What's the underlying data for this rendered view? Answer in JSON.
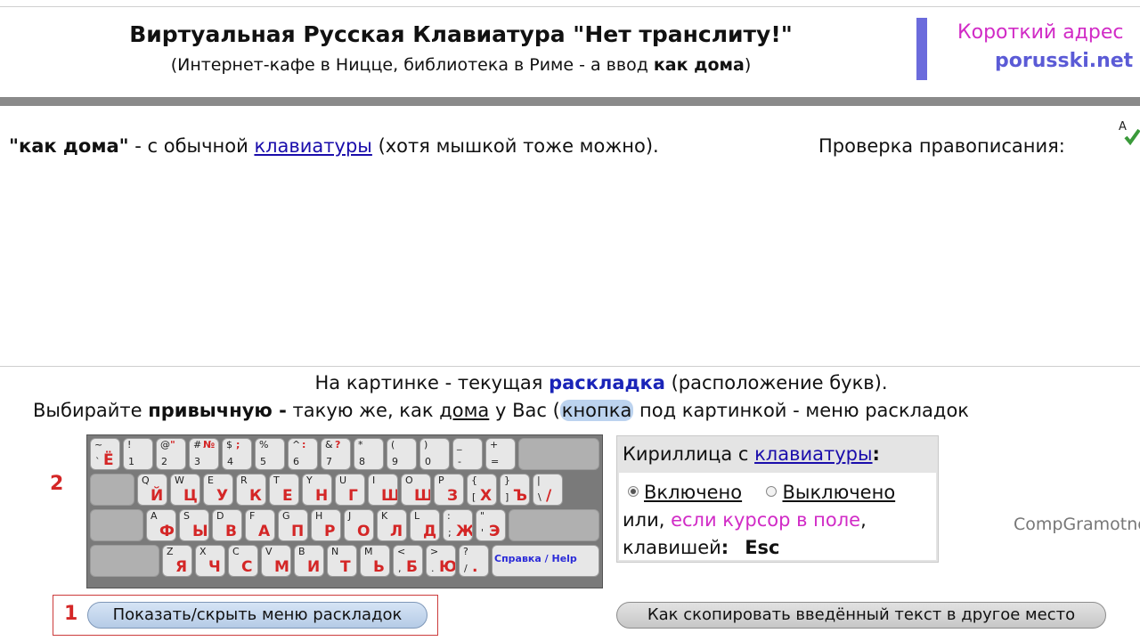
{
  "header": {
    "title": "Виртуальная Русская Клавиатура \"Нет транслиту!\"",
    "subtitle_pre": "(Интернет-кафе в Ницце, библиотека в Риме - а ввод ",
    "subtitle_bold": "как дома",
    "subtitle_post": ")",
    "short_label": "Короткий адрес",
    "short_url": "porusski.net"
  },
  "intro": {
    "bold": "\"как дома\"",
    "text1": " - с обычной ",
    "link": "клавиатуры",
    "text2": " (хотя мышкой тоже можно).",
    "spell_label": "Проверка правописания:",
    "spell_icon": "A"
  },
  "editor": {
    "value": "",
    "placeholder": ""
  },
  "layout_info": {
    "line1_pre": "На картинке - текущая ",
    "line1_bold": "раскладка",
    "line1_post": " (расположение букв).",
    "line2_pre": "Выбирайте ",
    "line2_bold": "привычную -",
    "line2_mid": " такую же, как ",
    "line2_link": "дома",
    "line2_mid2": " у Вас (",
    "line2_hl": "кнопка",
    "line2_post": " под картинкой - меню раскладок"
  },
  "markers": {
    "one": "1",
    "two": "2"
  },
  "keyboard": {
    "row1": [
      {
        "up": "~",
        "upr": "",
        "lo": "`",
        "cy": "Ё"
      },
      {
        "up": "!",
        "upr": "",
        "lo": "1",
        "cy": ""
      },
      {
        "up": "@",
        "upr": "\"",
        "lo": "2",
        "cy": ""
      },
      {
        "up": "#",
        "upr": "№",
        "lo": "3",
        "cy": ""
      },
      {
        "up": "$",
        "upr": ";",
        "lo": "4",
        "cy": ""
      },
      {
        "up": "%",
        "upr": "",
        "lo": "5",
        "cy": ""
      },
      {
        "up": "^",
        "upr": ":",
        "lo": "6",
        "cy": ""
      },
      {
        "up": "&",
        "upr": "?",
        "lo": "7",
        "cy": ""
      },
      {
        "up": "*",
        "upr": "",
        "lo": "8",
        "cy": ""
      },
      {
        "up": "(",
        "upr": "",
        "lo": "9",
        "cy": ""
      },
      {
        "up": ")",
        "upr": "",
        "lo": "0",
        "cy": ""
      },
      {
        "up": "_",
        "upr": "",
        "lo": "-",
        "cy": ""
      },
      {
        "up": "+",
        "upr": "",
        "lo": "=",
        "cy": ""
      }
    ],
    "row2": [
      {
        "up": "Q",
        "lo": "",
        "cy": "Й"
      },
      {
        "up": "W",
        "lo": "",
        "cy": "Ц"
      },
      {
        "up": "E",
        "lo": "",
        "cy": "У"
      },
      {
        "up": "R",
        "lo": "",
        "cy": "К"
      },
      {
        "up": "T",
        "lo": "",
        "cy": "Е"
      },
      {
        "up": "Y",
        "lo": "",
        "cy": "Н"
      },
      {
        "up": "U",
        "lo": "",
        "cy": "Г"
      },
      {
        "up": "I",
        "lo": "",
        "cy": "Ш"
      },
      {
        "up": "O",
        "lo": "",
        "cy": "Щ"
      },
      {
        "up": "P",
        "lo": "",
        "cy": "З"
      },
      {
        "up": "{",
        "lo": "[",
        "cy": "Х"
      },
      {
        "up": "}",
        "lo": "]",
        "cy": "Ъ"
      },
      {
        "up": "|",
        "lo": "\\",
        "cy": "/"
      }
    ],
    "row3": [
      {
        "up": "A",
        "lo": "",
        "cy": "Ф"
      },
      {
        "up": "S",
        "lo": "",
        "cy": "Ы"
      },
      {
        "up": "D",
        "lo": "",
        "cy": "В"
      },
      {
        "up": "F",
        "lo": "",
        "cy": "А"
      },
      {
        "up": "G",
        "lo": "",
        "cy": "П"
      },
      {
        "up": "H",
        "lo": "",
        "cy": "Р"
      },
      {
        "up": "J",
        "lo": "",
        "cy": "О"
      },
      {
        "up": "K",
        "lo": "",
        "cy": "Л"
      },
      {
        "up": "L",
        "lo": "",
        "cy": "Д"
      },
      {
        "up": ":",
        "lo": ";",
        "cy": "Ж"
      },
      {
        "up": "\"",
        "lo": "'",
        "cy": "Э"
      }
    ],
    "row4": [
      {
        "up": "Z",
        "lo": "",
        "cy": "Я"
      },
      {
        "up": "X",
        "lo": "",
        "cy": "Ч"
      },
      {
        "up": "C",
        "lo": "",
        "cy": "С"
      },
      {
        "up": "V",
        "lo": "",
        "cy": "М"
      },
      {
        "up": "B",
        "lo": "",
        "cy": "И"
      },
      {
        "up": "N",
        "lo": "",
        "cy": "Т"
      },
      {
        "up": "M",
        "lo": "",
        "cy": "Ь"
      },
      {
        "up": "<",
        "lo": ",",
        "cy": "Б"
      },
      {
        "up": ">",
        "lo": ".",
        "cy": "Ю"
      },
      {
        "up": "?",
        "lo": "/",
        "cy": "."
      }
    ],
    "help_label": "Справка / Help"
  },
  "panel": {
    "title_pre": "Кириллица с ",
    "title_link": "клавиатуры",
    "title_post": ":",
    "radio_on": "Включено",
    "radio_off": "Выключено",
    "line2_pre": "или, ",
    "line2_pink": "если курсор в поле",
    "line2_post": ",",
    "line3_pre": "клавишей",
    "line3_colon": ":",
    "line3_key": "Esc",
    "selected": "Включено"
  },
  "side_text": "CompGramotnost",
  "buttons": {
    "layouts_menu": "Показать/скрыть меню раскладок",
    "copy_help": "Как скопировать введённый текст в другое место"
  },
  "colors": {
    "accent_pink": "#d12bc6",
    "accent_blue": "#5b5bd6",
    "key_red": "#d42626",
    "link": "#1a0dab"
  }
}
